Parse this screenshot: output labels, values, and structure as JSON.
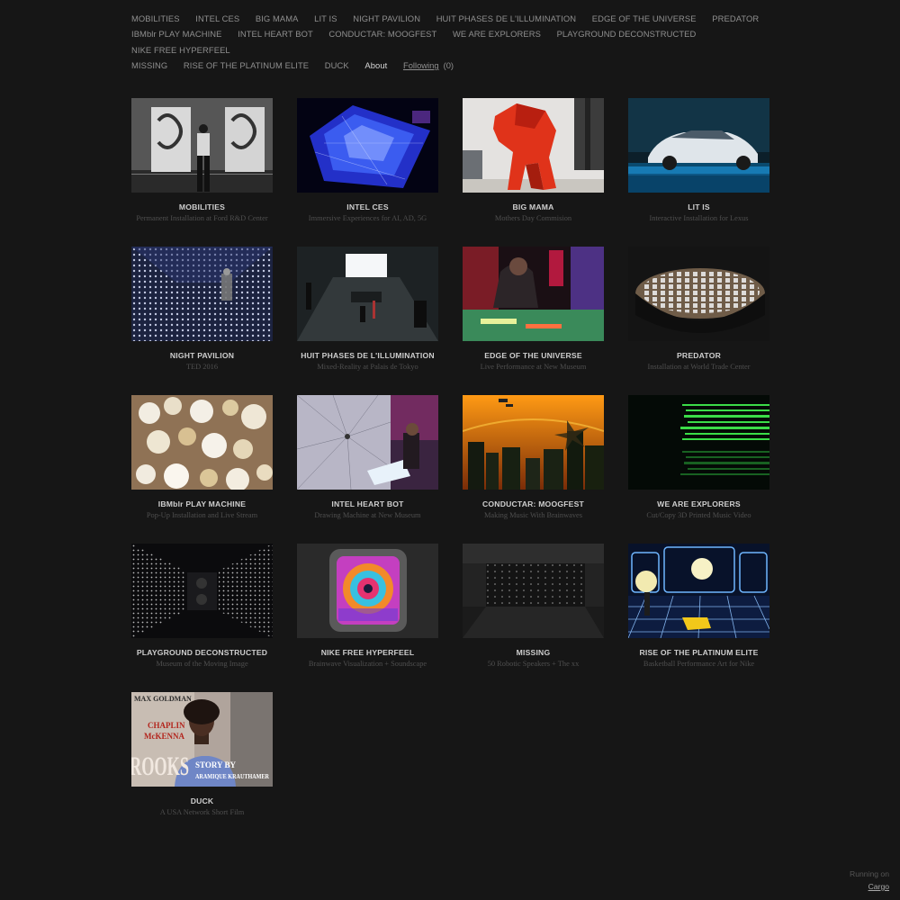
{
  "nav": {
    "items": [
      "MOBILITIES",
      "INTEL CES",
      "BIG MAMA",
      "LIT IS",
      "NIGHT PAVILION",
      "HUIT PHASES DE L'ILLUMINATION",
      "EDGE OF THE UNIVERSE",
      "PREDATOR",
      "IBMblr PLAY MACHINE",
      "INTEL HEART BOT",
      "CONDUCTAR: MOOGFEST",
      "WE ARE EXPLORERS",
      "PLAYGROUND DECONSTRUCTED",
      "NIKE FREE HYPERFEEL",
      "MISSING",
      "RISE OF THE PLATINUM ELITE",
      "DUCK",
      "About"
    ],
    "following_label": "Following",
    "following_count": "(0)"
  },
  "projects": [
    {
      "title": "MOBILITIES",
      "subtitle": "Permanent Installation at Ford R&D Center",
      "image": "gallery-man-panels"
    },
    {
      "title": "INTEL CES",
      "subtitle": "Immersive Experiences for AI, AD, 5G",
      "image": "blue-light-sculpture"
    },
    {
      "title": "BIG MAMA",
      "subtitle": "Mothers Day Commision",
      "image": "red-gorilla-sculpture"
    },
    {
      "title": "LIT IS",
      "subtitle": "Interactive Installation for Lexus",
      "image": "white-car-blue-light"
    },
    {
      "title": "NIGHT PAVILION",
      "subtitle": "TED 2016",
      "image": "light-dot-tunnel"
    },
    {
      "title": "HUIT PHASES DE L'ILLUMINATION",
      "subtitle": "Mixed-Reality at Palais de Tokyo",
      "image": "dark-room-screen"
    },
    {
      "title": "EDGE OF THE UNIVERSE",
      "subtitle": "Live Performance at New Museum",
      "image": "performer-colored-lights"
    },
    {
      "title": "PREDATOR",
      "subtitle": "Installation at World Trade Center",
      "image": "circular-robot-array"
    },
    {
      "title": "IBMblr PLAY MACHINE",
      "subtitle": "Pop-Up Installation and Live Stream",
      "image": "popcorn-closeup"
    },
    {
      "title": "INTEL HEART BOT",
      "subtitle": "Drawing Machine at New Museum",
      "image": "string-drawing-machine"
    },
    {
      "title": "CONDUCTAR: MOOGFEST",
      "subtitle": "Making Music With Brainwaves",
      "image": "orange-sky-city"
    },
    {
      "title": "WE ARE EXPLORERS",
      "subtitle": "Cut/Copy 3D Printed Music Video",
      "image": "green-light-waves"
    },
    {
      "title": "PLAYGROUND DECONSTRUCTED",
      "subtitle": "Museum of the Moving Image",
      "image": "speaker-light-tunnel"
    },
    {
      "title": "NIKE FREE HYPERFEEL",
      "subtitle": "Brainwave Visualization + Soundscape",
      "image": "psychedelic-eye-screen"
    },
    {
      "title": "MISSING",
      "subtitle": "50 Robotic Speakers + The xx",
      "image": "dark-hall-lights"
    },
    {
      "title": "RISE OF THE PLATINUM ELITE",
      "subtitle": "Basketball Performance Art for Nike",
      "image": "basketball-court-grid"
    },
    {
      "title": "DUCK",
      "subtitle": "A USA Network Short Film",
      "image": "film-poster-portrait",
      "poster_text": [
        "MAX GOLDMAN",
        "CHAPLIN",
        "McKENNA",
        "ROOKS",
        "STORY BY",
        "ARAMIQUE KRAUTHAMER"
      ]
    }
  ],
  "footer": {
    "running_on": "Running on",
    "link": "Cargo"
  }
}
